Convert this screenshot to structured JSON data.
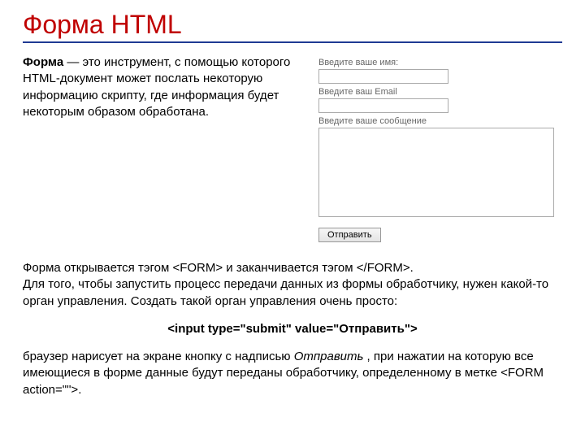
{
  "title": "Форма HTML",
  "intro": {
    "lead": "Форма",
    "rest": " — это инструмент, с помощью которого HTML-документ может послать некоторую информацию скрипту, где информация будет некоторым образом обработана."
  },
  "form": {
    "name_label": "Введите ваше имя:",
    "email_label": "Введите ваш Email",
    "message_label": "Введите ваше сообщение",
    "submit_label": "Отправить"
  },
  "para1": {
    "a": "Форма открывается тэгом ",
    "tag_open": "<FORM>",
    "b": " и заканчивается тэгом ",
    "tag_close": "</FORM>",
    "c": "."
  },
  "para2": "Для того, чтобы запустить процесс передачи данных из формы обработчику, нужен какой-то орган управления. Создать такой орган управления очень просто:",
  "code_line": "<input type=\"submit\" value=\"Отправить\">",
  "para3": {
    "a": "браузер нарисует на экране кнопку с надписью ",
    "btn_word": "Отправить",
    "b": " , при нажатии на которую все имеющиеся в форме данные будут переданы обработчику, определенному в метке ",
    "action_tag": "<FORM action=\"\">",
    "c": "."
  }
}
